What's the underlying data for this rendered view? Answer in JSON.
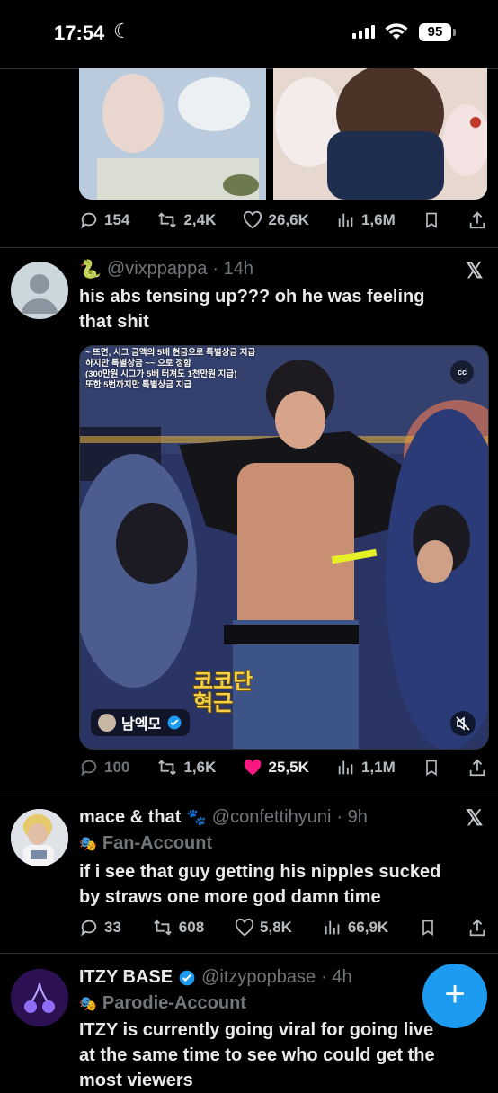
{
  "status_bar": {
    "time": "17:54",
    "battery": "95"
  },
  "tweets": [
    {
      "stats": {
        "replies": "154",
        "reposts": "2,4K",
        "likes": "26,6K",
        "views": "1,6M"
      }
    },
    {
      "emoji": "🐍",
      "handle": "@vixppappa",
      "time": "· 14h",
      "text_line1": "his abs tensing up??? oh he was feeling",
      "text_line2": "that shit",
      "media": {
        "caption_lines": [
          "~ 뜨면, 시그 금액의 5배 현금으로 특별상금 지급",
          "하지만 특별상금 ~~ 으로 정함",
          "(300만원 시그가 5배 터져도 1천만원 지급)",
          "또한 5번까지만 특별상금 지급"
        ],
        "overlay_korean_line1": "코코단",
        "overlay_korean_line2": "혁근",
        "credit": "남엑모",
        "cc": "cc"
      },
      "stats": {
        "replies": "100",
        "reposts": "1,6K",
        "likes": "25,5K",
        "views": "1,1M"
      }
    },
    {
      "name": "mace & that",
      "name_emoji": "🐾",
      "handle": "@confettihyuni",
      "time": "· 9h",
      "label": "Fan-Account",
      "text_line1": "if i see that guy getting his nipples sucked",
      "text_line2": "by straws one more god damn time",
      "stats": {
        "replies": "33",
        "reposts": "608",
        "likes": "5,8K",
        "views": "66,9K"
      }
    },
    {
      "name": "ITZY BASE",
      "handle": "@itzypopbase",
      "time": "· 4h",
      "label": "Parodie-Account",
      "text_line1": "ITZY is currently going viral for going live",
      "text_line2": "at the same time to see who could get the",
      "text_line3": "most viewers"
    }
  ],
  "fab": {
    "label": "+"
  },
  "colors": {
    "accent": "#1d9bf0",
    "like": "#f91880",
    "verified": "#1d9bf0"
  }
}
